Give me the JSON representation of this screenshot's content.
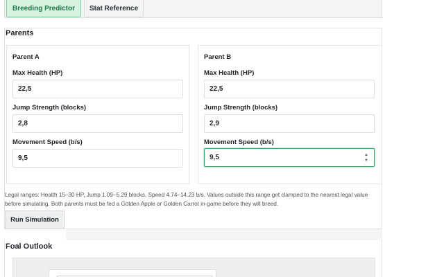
{
  "tabs": [
    {
      "label": "Breeding Predictor",
      "active": true
    },
    {
      "label": "Stat Reference",
      "active": false
    }
  ],
  "parents_section": {
    "title": "Parents",
    "parent_a": {
      "title": "Parent A",
      "health_label": "Max Health (HP)",
      "health_value": "22,5",
      "jump_label": "Jump Strength (blocks)",
      "jump_value": "2,8",
      "speed_label": "Movement Speed (b/s)",
      "speed_value": "9,5"
    },
    "parent_b": {
      "title": "Parent B",
      "health_label": "Max Health (HP)",
      "health_value": "22,5",
      "jump_label": "Jump Strength (blocks)",
      "jump_value": "2,9",
      "speed_label": "Movement Speed (b/s)",
      "speed_value": "9,5"
    },
    "help_text": "Legal ranges: Health 15–30 HP, Jump 1.09–5.29 blocks, Speed 4.74–14.23 b/s. Values outside this range get clamped to the nearest legal value before simulating. Both parents must be fed a Golden Apple or Golden Carrot in-game before they will breed.",
    "run_button": "Run Simulation"
  },
  "foal_section": {
    "title": "Foal Outlook"
  },
  "colors": {
    "accent": "#3aa56b",
    "active_tab_bg": "#d6f3e2",
    "active_tab_text": "#1b7a45"
  }
}
